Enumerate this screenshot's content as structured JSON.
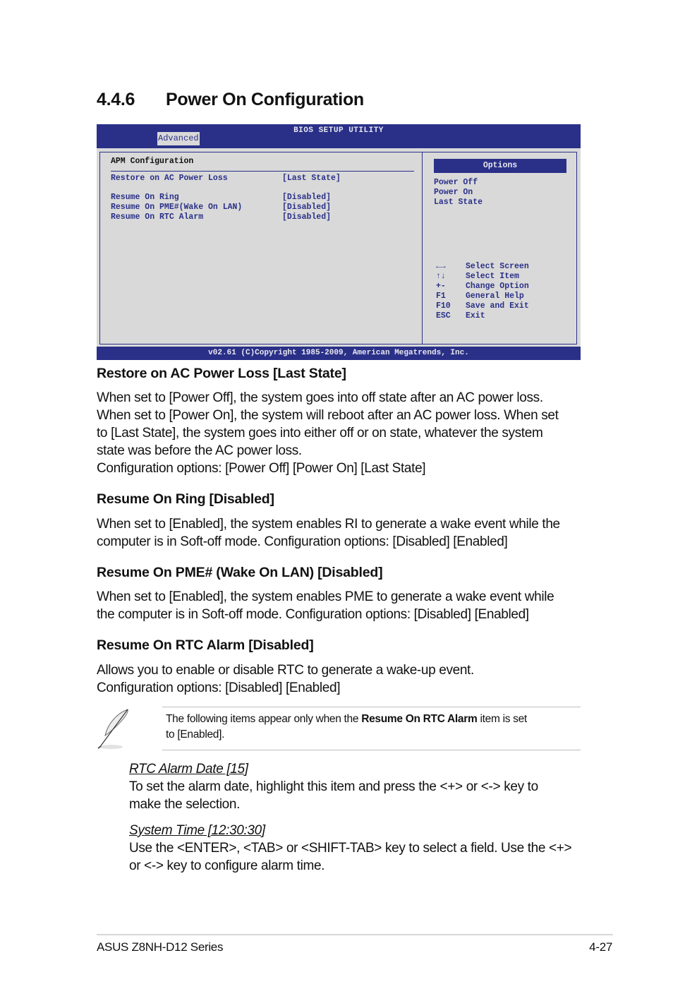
{
  "section": {
    "number": "4.4.6",
    "title": "Power On Configuration"
  },
  "bios": {
    "title": "BIOS SETUP UTILITY",
    "active_tab": "Advanced",
    "panel_title": "APM Configuration",
    "items": [
      {
        "label": "Restore on AC Power Loss",
        "value": "[Last State]"
      },
      {
        "label": "Resume On Ring",
        "value": "[Disabled]"
      },
      {
        "label": "Resume On PME#(Wake On LAN)",
        "value": "[Disabled]"
      },
      {
        "label": "Resume On RTC Alarm",
        "value": "[Disabled]"
      }
    ],
    "options_title": "Options",
    "options": [
      "Power Off",
      "Power On",
      "Last State"
    ],
    "keys": [
      {
        "key": "←→",
        "action": "Select Screen"
      },
      {
        "key": "↑↓",
        "action": "Select Item"
      },
      {
        "key": "+-",
        "action": "Change Option"
      },
      {
        "key": "F1",
        "action": "General Help"
      },
      {
        "key": "F10",
        "action": "Save and Exit"
      },
      {
        "key": "ESC",
        "action": "Exit"
      }
    ],
    "footer": "v02.61 (C)Copyright 1985-2009, American Megatrends, Inc."
  },
  "sections": [
    {
      "heading": "Restore on AC Power Loss [Last State]",
      "lines": [
        "When set to [Power Off], the system goes into off state after an AC power loss.",
        "When set to [Power On], the system will reboot after an AC power loss. When set",
        "to [Last State], the system goes into either off or on state, whatever the system",
        "state was before the AC power loss.",
        "Configuration options: [Power Off] [Power On] [Last State]"
      ]
    },
    {
      "heading": "Resume On Ring [Disabled]",
      "lines": [
        "When set to [Enabled], the system enables RI to generate a wake event while the",
        "computer is in Soft-off mode. Configuration options: [Disabled] [Enabled]"
      ]
    },
    {
      "heading": "Resume On PME# (Wake On LAN) [Disabled]",
      "lines": [
        "When set to [Enabled], the system enables PME to generate a wake event while",
        "the computer is in Soft-off mode. Configuration options: [Disabled] [Enabled]"
      ]
    },
    {
      "heading": "Resume On RTC Alarm [Disabled]",
      "lines": [
        "Allows you to enable or disable RTC to generate a wake-up event.",
        "Configuration options: [Disabled] [Enabled]"
      ]
    }
  ],
  "note": {
    "icon": "feather-pen-icon",
    "prefix": "The following items appear only when the ",
    "bold": "Resume On RTC Alarm",
    "suffix": " item is set",
    "line2": "to [Enabled]."
  },
  "sub_items": [
    {
      "title": "RTC Alarm Date [15]",
      "lines": [
        "To set the alarm date, highlight this item and press the <+> or <-> key to",
        "make the selection."
      ]
    },
    {
      "title": "System Time [12:30:30]",
      "lines": [
        "Use the <ENTER>, <TAB> or <SHIFT-TAB> key to select a field. Use the <+>",
        "or <-> key to configure alarm time."
      ]
    }
  ],
  "footer": {
    "left": "ASUS Z8NH-D12 Series",
    "right": "4-27"
  }
}
